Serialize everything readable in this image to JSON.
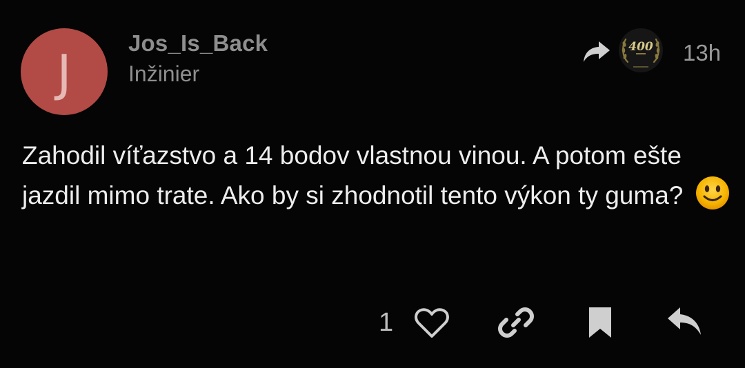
{
  "post": {
    "avatar_letter": "J",
    "username": "Jos_Is_Back",
    "user_title": "Inžinier",
    "timestamp": "13h",
    "badge_text": "400",
    "text": "Zahodil víťazstvo a 14 bodov vlastnou vinou. A potom ešte jazdil mimo trate. Ako by si zhodnotil tento výkon ty guma?",
    "emoji": "slightly-smiling-face",
    "like_count": "1"
  },
  "colors": {
    "background": "#050505",
    "avatar": "#b24a46",
    "text_primary": "#ededed",
    "text_muted": "#8e8e8e",
    "icon": "#cfcfcf"
  },
  "icons": {
    "share": "share-icon",
    "like": "heart-icon",
    "link": "link-icon",
    "bookmark": "bookmark-icon",
    "reply": "reply-icon"
  }
}
